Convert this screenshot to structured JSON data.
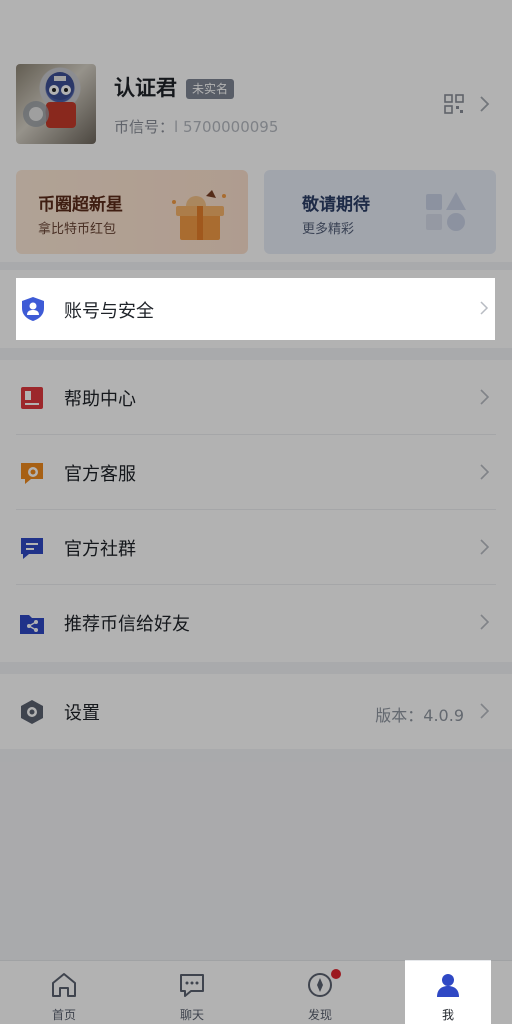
{
  "profile": {
    "username": "认证君",
    "badge": "未实名",
    "coin_id_label": "币信号：",
    "coin_id_value": "l        5700000095"
  },
  "cards": [
    {
      "title": "币圈超新星",
      "subtitle": "拿比特币红包",
      "icon": "gift-box-icon"
    },
    {
      "title": "敬请期待",
      "subtitle": "更多精彩",
      "icon": "shapes-icon"
    }
  ],
  "menu": {
    "account_security": {
      "label": "账号与安全",
      "icon": "shield-user-icon",
      "icon_color": "#3e5bd6"
    },
    "group2": [
      {
        "label": "帮助中心",
        "icon": "help-book-icon",
        "icon_color": "#e0383e"
      },
      {
        "label": "官方客服",
        "icon": "service-chat-icon",
        "icon_color": "#f08a1d"
      },
      {
        "label": "官方社群",
        "icon": "community-chat-icon",
        "icon_color": "#2f48c4"
      },
      {
        "label": "推荐币信给好友",
        "icon": "share-folder-icon",
        "icon_color": "#2f48c4"
      }
    ],
    "settings": {
      "label": "设置",
      "version_label": "版本：4.0.9",
      "icon": "settings-hex-icon"
    }
  },
  "tabs": [
    {
      "label": "首页",
      "icon": "home-icon"
    },
    {
      "label": "聊天",
      "icon": "chat-icon"
    },
    {
      "label": "发现",
      "icon": "compass-icon",
      "badge_dot": true
    },
    {
      "label": "我",
      "icon": "user-icon",
      "active": true
    }
  ],
  "colors": {
    "accent": "#2f48c4",
    "red_dot": "#e0252f",
    "overlay": "rgba(0,0,0,0.30)"
  }
}
